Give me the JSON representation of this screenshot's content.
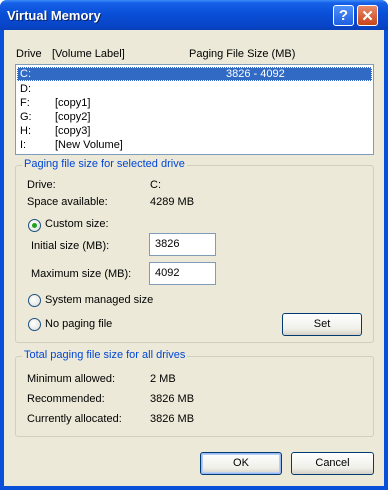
{
  "window": {
    "title": "Virtual Memory"
  },
  "list_header": {
    "drive": "Drive",
    "volume_label": "[Volume Label]",
    "paging_size": "Paging File Size (MB)"
  },
  "drives": [
    {
      "drive": "C:",
      "label": "",
      "paging": "3826 - 4092",
      "selected": true
    },
    {
      "drive": "D:",
      "label": "",
      "paging": ""
    },
    {
      "drive": "F:",
      "label": "[copy1]",
      "paging": ""
    },
    {
      "drive": "G:",
      "label": "[copy2]",
      "paging": ""
    },
    {
      "drive": "H:",
      "label": "[copy3]",
      "paging": ""
    },
    {
      "drive": "I:",
      "label": "[New Volume]",
      "paging": ""
    }
  ],
  "selected_group": {
    "legend": "Paging file size for selected drive",
    "drive_label": "Drive:",
    "drive_value": "C:",
    "space_label": "Space available:",
    "space_value": "4289 MB",
    "custom_size": "Custom size:",
    "initial_label": "Initial size (MB):",
    "initial_value": "3826",
    "maximum_label": "Maximum size (MB):",
    "maximum_value": "4092",
    "system_managed": "System managed size",
    "no_paging": "No paging file",
    "set_button": "Set",
    "selected_option": "custom"
  },
  "total_group": {
    "legend": "Total paging file size for all drives",
    "min_label": "Minimum allowed:",
    "min_value": "2 MB",
    "rec_label": "Recommended:",
    "rec_value": "3826 MB",
    "cur_label": "Currently allocated:",
    "cur_value": "3826 MB"
  },
  "buttons": {
    "ok": "OK",
    "cancel": "Cancel"
  },
  "colors": {
    "titlebar": "#0a4fd8",
    "dialog_bg": "#ece9d8",
    "selection": "#316ac5",
    "group_legend": "#0046d5"
  }
}
